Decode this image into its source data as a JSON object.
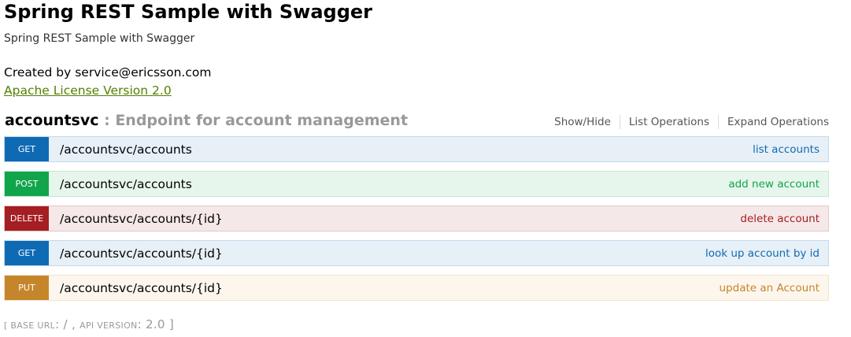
{
  "info": {
    "title": "Spring REST Sample with Swagger",
    "description": "Spring REST Sample with Swagger",
    "contact": "Created by service@ericsson.com",
    "license": "Apache License Version 2.0"
  },
  "resource": {
    "name": "accountsvc",
    "separator": " : ",
    "description": "Endpoint for account management",
    "options": [
      "Show/Hide",
      "List Operations",
      "Expand Operations"
    ]
  },
  "operations": [
    {
      "method": "GET",
      "path": "/accountsvc/accounts",
      "summary": "list accounts"
    },
    {
      "method": "POST",
      "path": "/accountsvc/accounts",
      "summary": "add new account"
    },
    {
      "method": "DELETE",
      "path": "/accountsvc/accounts/{id}",
      "summary": "delete account"
    },
    {
      "method": "GET",
      "path": "/accountsvc/accounts/{id}",
      "summary": "look up account by id"
    },
    {
      "method": "PUT",
      "path": "/accountsvc/accounts/{id}",
      "summary": "update an Account"
    }
  ],
  "footer": {
    "open": "[ ",
    "base_url_label": "BASE URL",
    "base_url_value": ": /",
    "mid": " , ",
    "api_version_label": "API VERSION",
    "api_version_value": ": 2.0",
    "close": " ]"
  },
  "colors": {
    "GET": "#0f6ab4",
    "POST": "#10a54a",
    "DELETE": "#a41e22",
    "PUT": "#c5862b",
    "license_link": "#547f00"
  }
}
